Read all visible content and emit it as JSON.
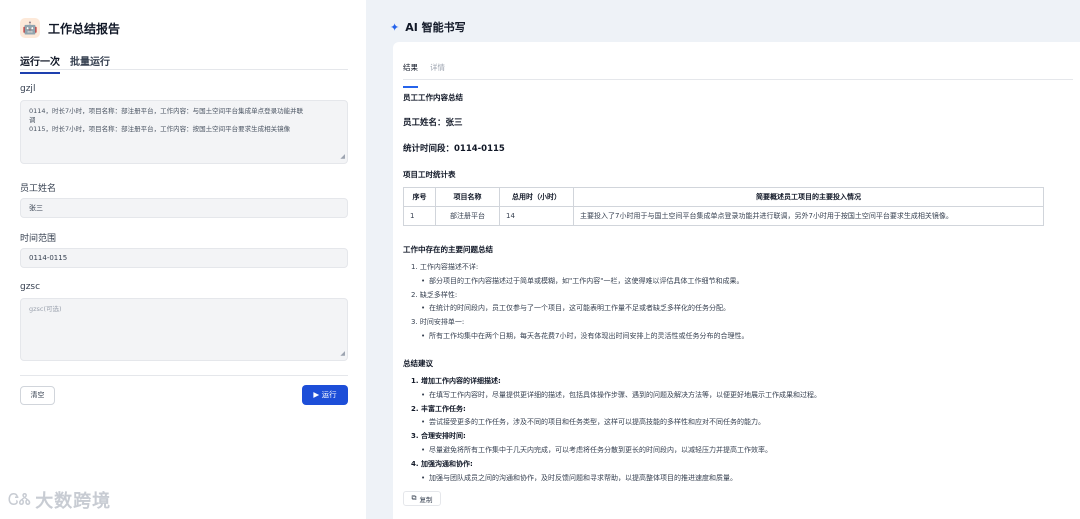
{
  "app": {
    "title": "工作总结报告",
    "logo_icon": "robot-avatar-icon"
  },
  "tabs": [
    {
      "label": "运行一次"
    },
    {
      "label": "批量运行"
    }
  ],
  "form": {
    "gzjl": {
      "label": "gzjl",
      "value_lines": [
        "0114，时长7小时，项目名称：部注册平台，工作内容：与国土空间平台集成单点登录功能并联",
        "调",
        "0115，时长7小时，项目名称：部注册平台，工作内容：按国土空间平台要求生成相关镜像"
      ]
    },
    "name": {
      "label": "员工姓名",
      "value": "张三"
    },
    "range": {
      "label": "时间范围",
      "value": "0114-0115"
    },
    "gzsc": {
      "label": "gzsc",
      "placeholder": "gzsc(可选)"
    }
  },
  "buttons": {
    "clear": "清空",
    "run": "运行"
  },
  "right": {
    "title": "AI 智能书写",
    "tabs": [
      {
        "label": "结果"
      },
      {
        "label": "详情"
      }
    ],
    "report": {
      "heading": "员工工作内容总结",
      "name_line": "员工姓名：张三",
      "period_line": "统计时间段：0114-0115",
      "table_title": "项目工时统计表",
      "table_headers": [
        "序号",
        "项目名称",
        "总用时（小时）",
        "简要概述员工项目的主要投入情况"
      ],
      "table_rows": [
        [
          "1",
          "部注册平台",
          "14",
          "主要投入了7小时用于与国土空间平台集成单点登录功能并进行联调，另外7小时用于按国土空间平台要求生成相关镜像。"
        ]
      ],
      "problems_title": "工作中存在的主要问题总结",
      "problems": [
        {
          "title": "1. 工作内容描述不详:",
          "bullet": "部分项目的工作内容描述过于简单或模糊，如\"工作内容\"一栏，这使得难以评估具体工作细节和成果。"
        },
        {
          "title": "2. 缺乏多样性:",
          "bullet": "在统计的时间段内，员工仅参与了一个项目，这可能表明工作量不足或者缺乏多样化的任务分配。"
        },
        {
          "title": "3. 时间安排单一:",
          "bullet": "所有工作均集中在两个日期，每天各花费7小时，没有体现出时间安排上的灵活性或任务分布的合理性。"
        }
      ],
      "suggestions_title": "总结建议",
      "suggestions": [
        {
          "title": "1. 增加工作内容的详细描述:",
          "bullet": "在填写工作内容时，尽量提供更详细的描述，包括具体操作步骤、遇到的问题及解决方法等，以便更好地展示工作成果和过程。"
        },
        {
          "title": "2. 丰富工作任务:",
          "bullet": "尝试接受更多的工作任务，涉及不同的项目和任务类型，这样可以提高技能的多样性和应对不同任务的能力。"
        },
        {
          "title": "3. 合理安排时间:",
          "bullet": "尽量避免将所有工作集中于几天内完成，可以考虑将任务分散到更长的时间段内，以减轻压力并提高工作效率。"
        },
        {
          "title": "4. 加强沟通和协作:",
          "bullet": "加强与团队成员之间的沟通和协作，及时反馈问题和寻求帮助，以提高整体项目的推进速度和质量。"
        }
      ]
    },
    "copy_label": "复制"
  },
  "watermark": "大数跨境",
  "colors": {
    "accent": "#1d4ed8",
    "background": "#eef2f7"
  }
}
